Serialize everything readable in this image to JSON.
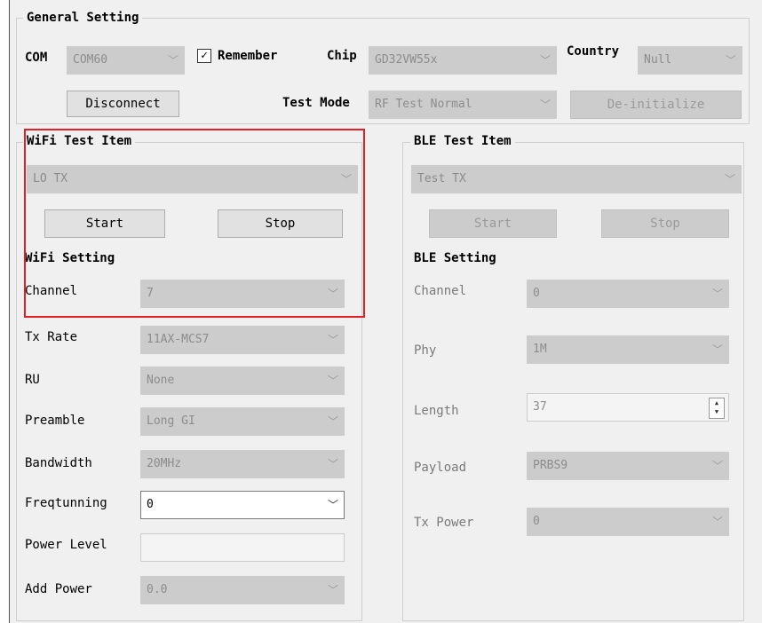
{
  "general": {
    "title": "General Setting",
    "com_label": "COM",
    "com_value": "COM60",
    "remember_label": "Remember",
    "remember_checked": "✓",
    "chip_label": "Chip",
    "chip_value": "GD32VW55x",
    "country_label": "Country",
    "country_value": "Null",
    "disconnect_label": "Disconnect",
    "test_mode_label": "Test Mode",
    "test_mode_value": "RF Test Normal",
    "deinit_label": "De-initialize"
  },
  "wifi": {
    "test_item_title": "WiFi Test Item",
    "test_item_value": "LO TX",
    "start_label": "Start",
    "stop_label": "Stop",
    "setting_title": "WiFi Setting",
    "channel_label": "Channel",
    "channel_value": "7",
    "tx_rate_label": "Tx Rate",
    "tx_rate_value": "11AX-MCS7",
    "ru_label": "RU",
    "ru_value": "None",
    "preamble_label": "Preamble",
    "preamble_value": "Long GI",
    "bandwidth_label": "Bandwidth",
    "bandwidth_value": "20MHz",
    "freqtunning_label": "Freqtunning",
    "freqtunning_value": "0",
    "power_level_label": "Power Level",
    "power_level_value": "",
    "add_power_label": "Add Power",
    "add_power_value": "0.0"
  },
  "ble": {
    "test_item_title": "BLE Test Item",
    "test_item_value": "Test TX",
    "start_label": "Start",
    "stop_label": "Stop",
    "setting_title": "BLE Setting",
    "channel_label": "Channel",
    "channel_value": "0",
    "phy_label": "Phy",
    "phy_value": "1M",
    "length_label": "Length",
    "length_value": "37",
    "payload_label": "Payload",
    "payload_value": "PRBS9",
    "tx_power_label": "Tx Power",
    "tx_power_value": "0"
  },
  "icons": {
    "chevron": "chevron-down-icon",
    "spin": "spin-updown-icon",
    "check": "check-icon"
  },
  "colors": {
    "highlight": "#e21f26",
    "window_bg": "#f0f0f0",
    "disabled_field": "#cccccc"
  }
}
